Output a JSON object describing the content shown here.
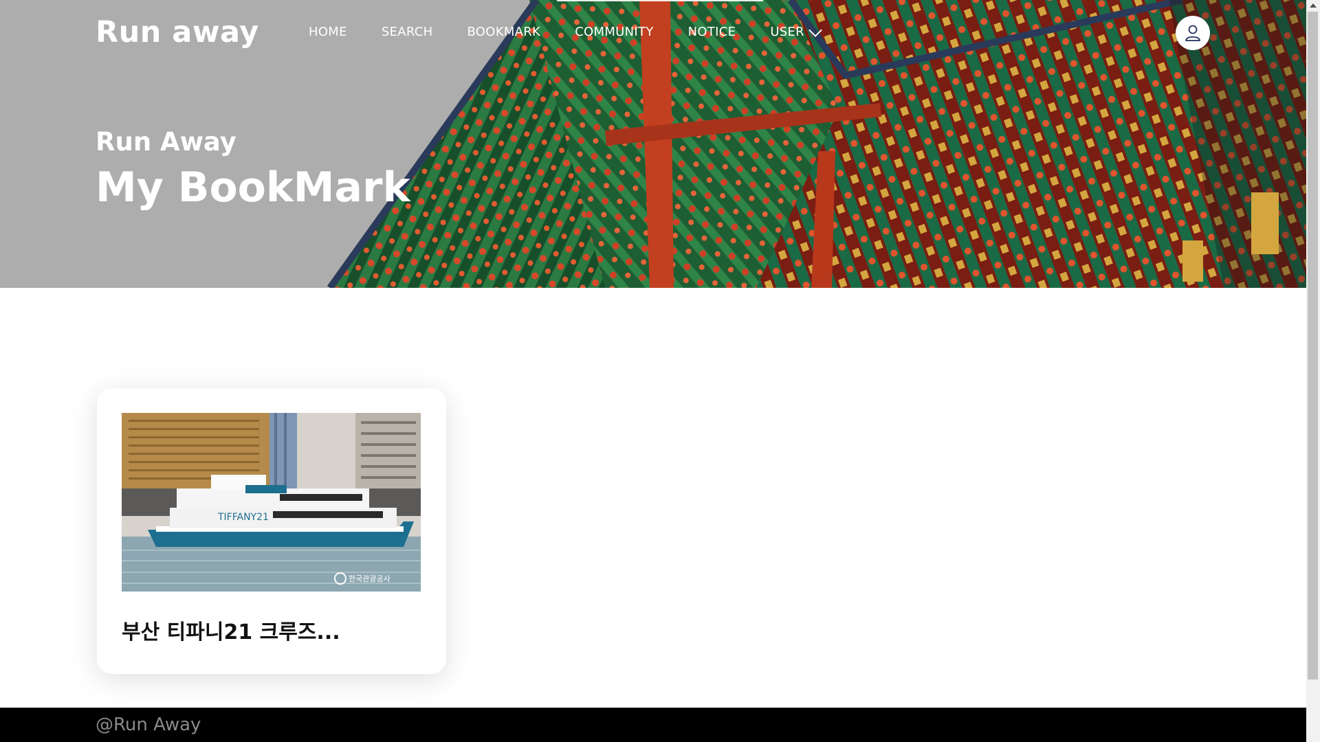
{
  "header": {
    "logo": "Run away",
    "nav": {
      "home": "HOME",
      "search": "SEARCH",
      "bookmark": "BOOKMARK",
      "community": "COMMUNITY",
      "notice": "NOTICE",
      "user": "USER"
    },
    "icons": {
      "user_menu": "chevron-down-icon",
      "account": "user-icon"
    }
  },
  "hero": {
    "subtitle": "Run Away",
    "title": "My BookMark"
  },
  "bookmarks": [
    {
      "title": "부산 티파니21 크루즈...",
      "image_text": "TIFFANY21",
      "watermark": "한국관광공사"
    }
  ],
  "footer": {
    "text": "@Run Away"
  },
  "colors": {
    "hero_gray": "#adadad",
    "roof_green": "#1f6b3a",
    "roof_red": "#c2401f",
    "footer_bg": "#000000",
    "footer_text": "#8a8a8a"
  }
}
